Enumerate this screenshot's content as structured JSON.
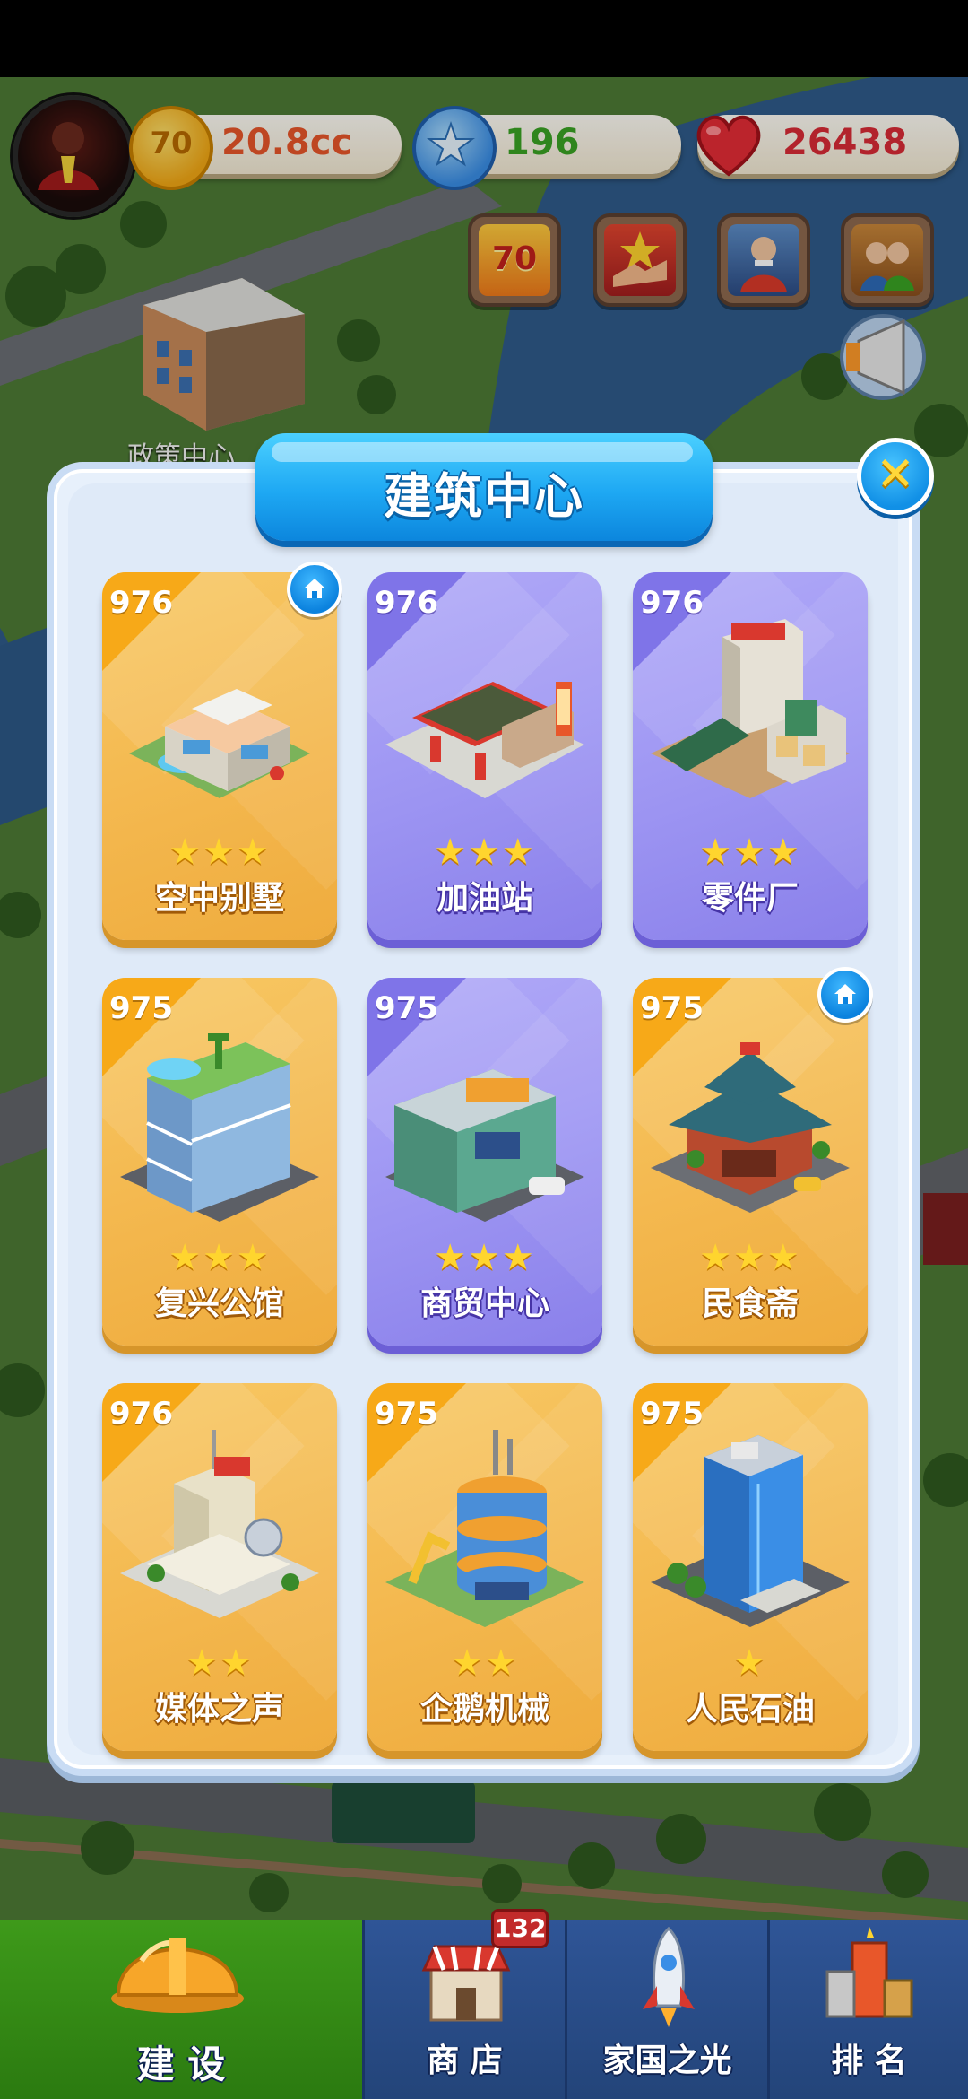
{
  "hud": {
    "coins": "20.8cc",
    "stars": "196",
    "hearts": "26438",
    "coin_badge": "70",
    "event_badge": "70"
  },
  "map": {
    "label_policy_center": "政策中心"
  },
  "dialog": {
    "title": "建筑中心",
    "close_symbol": "✕"
  },
  "buildings": [
    {
      "name": "空中别墅",
      "level": "976",
      "stars": 3,
      "stars_text": "★★★",
      "theme": "gold",
      "home": true
    },
    {
      "name": "加油站",
      "level": "976",
      "stars": 3,
      "stars_text": "★★★",
      "theme": "purple",
      "home": false
    },
    {
      "name": "零件厂",
      "level": "976",
      "stars": 3,
      "stars_text": "★★★",
      "theme": "purple",
      "home": false
    },
    {
      "name": "复兴公馆",
      "level": "975",
      "stars": 3,
      "stars_text": "★★★",
      "theme": "gold",
      "home": false
    },
    {
      "name": "商贸中心",
      "level": "975",
      "stars": 3,
      "stars_text": "★★★",
      "theme": "purple",
      "home": false
    },
    {
      "name": "民食斋",
      "level": "975",
      "stars": 3,
      "stars_text": "★★★",
      "theme": "gold",
      "home": true
    },
    {
      "name": "媒体之声",
      "level": "976",
      "stars": 2,
      "stars_text": "★★",
      "theme": "gold",
      "home": false
    },
    {
      "name": "企鹅机械",
      "level": "975",
      "stars": 2,
      "stars_text": "★★",
      "theme": "gold",
      "home": false
    },
    {
      "name": "人民石油",
      "level": "975",
      "stars": 1,
      "stars_text": "★",
      "theme": "gold",
      "home": false
    }
  ],
  "nav": {
    "build": "建 设",
    "shop": "商 店",
    "shop_badge": "132",
    "light": "家国之光",
    "rank": "排 名"
  },
  "colors": {
    "card_gold": "#f3b64c",
    "card_purple": "#9c94f2",
    "title_blue": "#1ea8f3",
    "star_yellow": "#ffd52e",
    "coin_text": "#e8562a",
    "star_text": "#3aa324",
    "heart_text": "#d92b36"
  }
}
